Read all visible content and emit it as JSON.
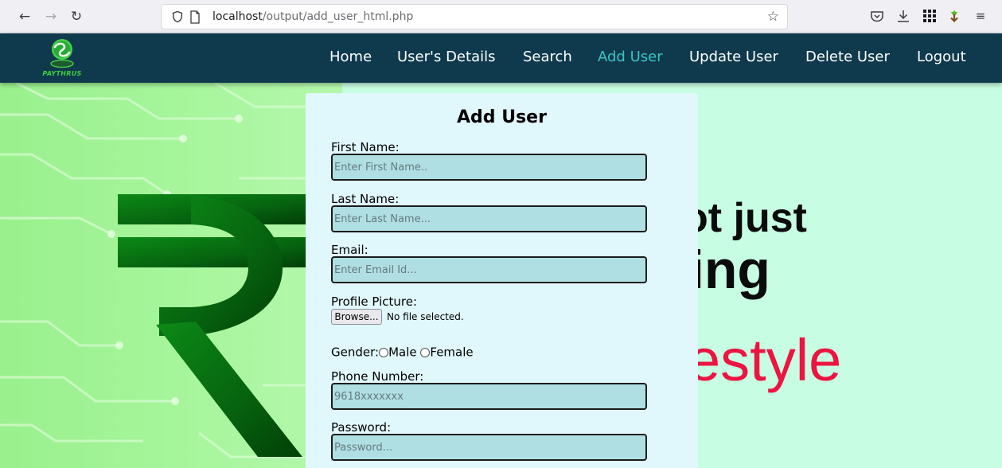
{
  "browser": {
    "url_host": "localhost",
    "url_path": "/output/add_user_html.php"
  },
  "site": {
    "logo_text": "PAYTHRUS",
    "nav": [
      {
        "label": "Home",
        "active": false
      },
      {
        "label": "User's Details",
        "active": false
      },
      {
        "label": "Search",
        "active": false
      },
      {
        "label": "Add User",
        "active": true
      },
      {
        "label": "Update User",
        "active": false
      },
      {
        "label": "Delete User",
        "active": false
      },
      {
        "label": "Logout",
        "active": false
      }
    ]
  },
  "background": {
    "slogan_line1": "ot just",
    "slogan_line2": "ing",
    "slogan_line3": "estyle"
  },
  "form": {
    "title": "Add User",
    "first_name_label": "First Name:",
    "first_name_placeholder": "Enter First Name..",
    "last_name_label": "Last Name:",
    "last_name_placeholder": "Enter Last Name...",
    "email_label": "Email:",
    "email_placeholder": "Enter Email Id...",
    "picture_label": "Profile Picture:",
    "browse_label": "Browse...",
    "file_status": "No file selected.",
    "gender_label": "Gender:",
    "gender_male": "Male",
    "gender_female": "Female",
    "phone_label": "Phone Number:",
    "phone_placeholder": "9618xxxxxxx",
    "password_label": "Password:",
    "password_placeholder": "Password..."
  },
  "colors": {
    "nav_bg": "#0f3a4d",
    "nav_active": "#39c4c4",
    "form_bg": "#e0f7fc",
    "input_bg": "#afdfe3",
    "slogan_red": "#ec1440"
  }
}
